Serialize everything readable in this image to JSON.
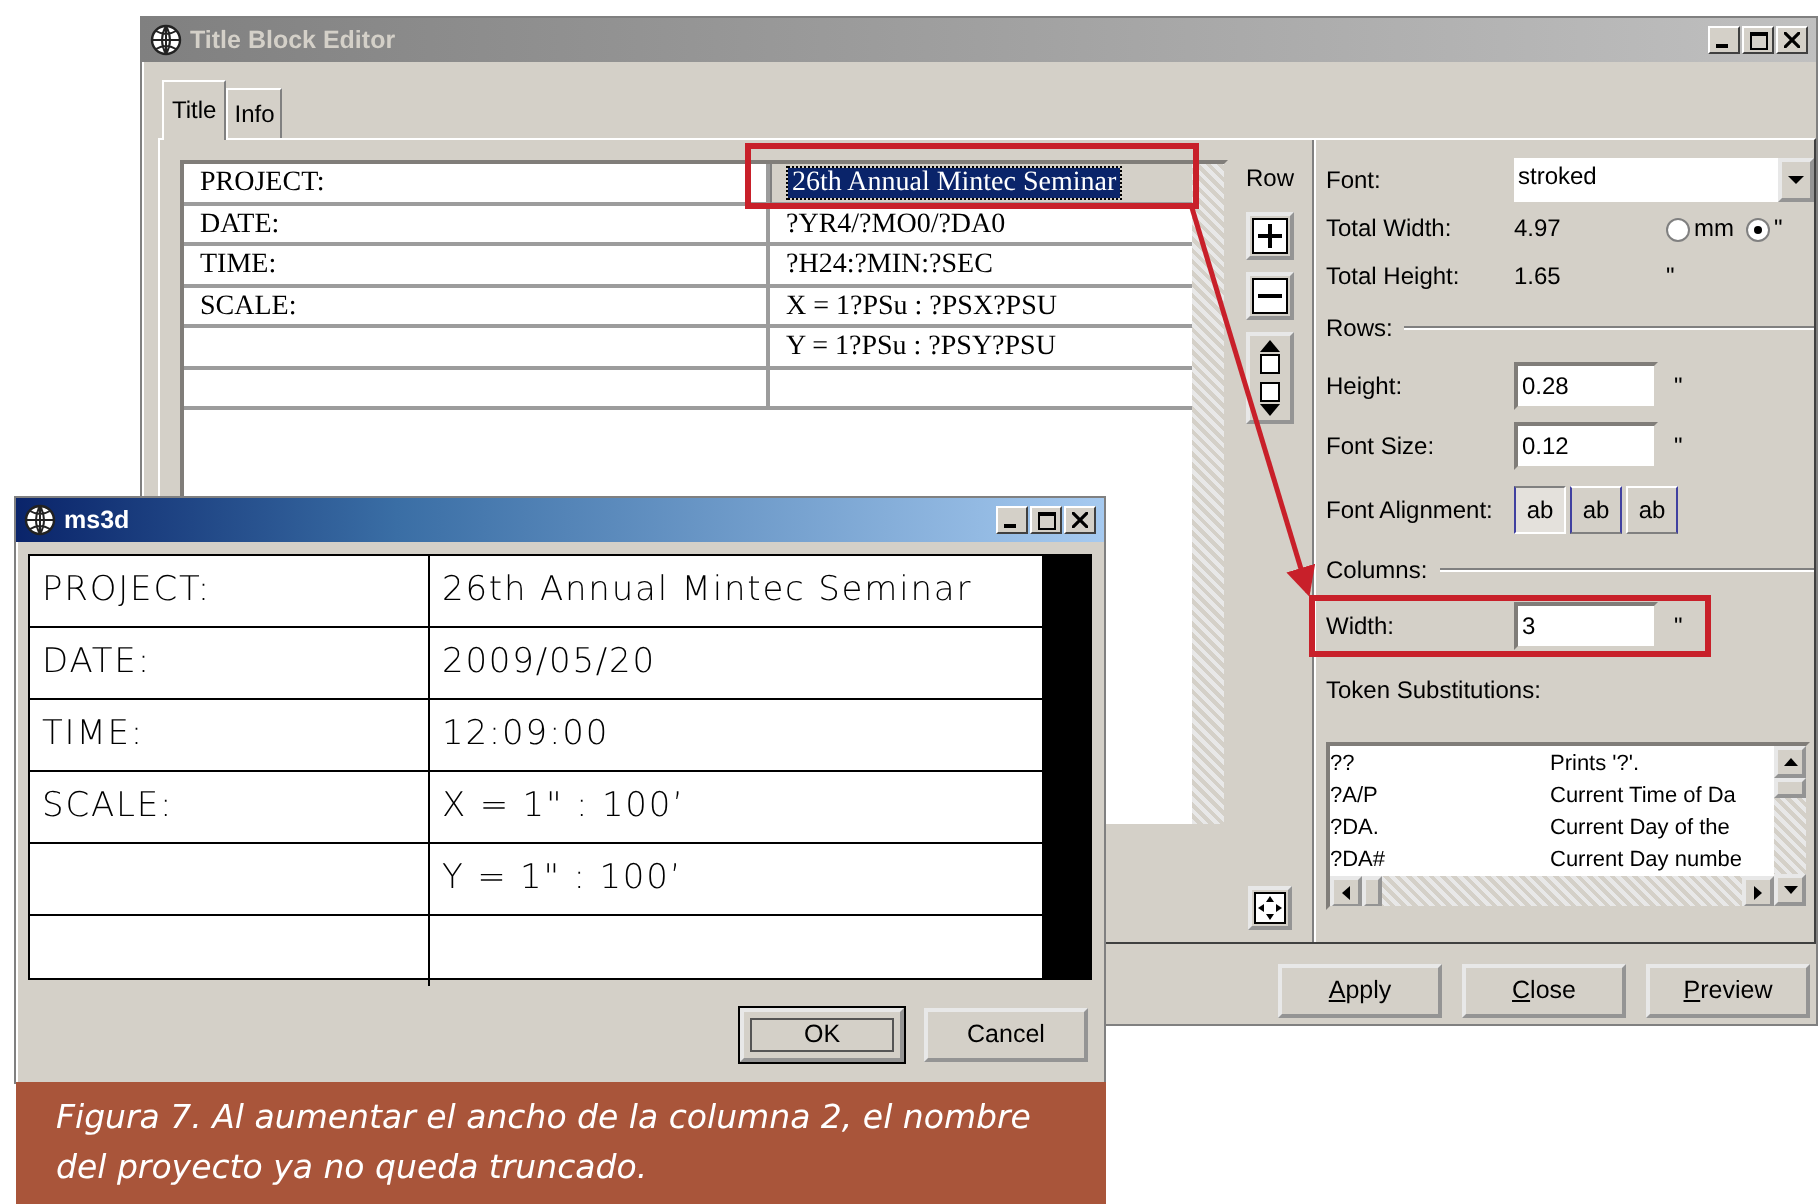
{
  "editor": {
    "title": "Title Block Editor",
    "tabs": [
      {
        "label": "Title",
        "selected": true
      },
      {
        "label": "Info",
        "selected": false
      }
    ],
    "grid_rows": [
      {
        "label": "PROJECT:",
        "value": "26th Annual Mintec Seminar",
        "selected": true
      },
      {
        "label": "DATE:",
        "value": "?YR4/?MO0/?DA0",
        "selected": false
      },
      {
        "label": "TIME:",
        "value": "?H24:?MIN:?SEC",
        "selected": false
      },
      {
        "label": "SCALE:",
        "value": "X = 1?PSu : ?PSX?PSU",
        "selected": false
      },
      {
        "label": "",
        "value": "Y = 1?PSu : ?PSY?PSU",
        "selected": false
      },
      {
        "label": "",
        "value": "",
        "selected": false
      }
    ],
    "row_label": "Row",
    "font": {
      "label": "Font:",
      "value": "stroked"
    },
    "total_width": {
      "label": "Total Width:",
      "value": "4.97"
    },
    "units": [
      {
        "label": "mm",
        "selected": false
      },
      {
        "label": "\"",
        "selected": true
      }
    ],
    "total_height": {
      "label": "Total Height:",
      "value": "1.65",
      "unit": "\""
    },
    "rows_heading": "Rows:",
    "row_fields": [
      {
        "label": "Height:",
        "value": "0.28",
        "unit": "\""
      },
      {
        "label": "Font Size:",
        "value": "0.12",
        "unit": "\""
      }
    ],
    "font_alignment": {
      "label": "Font Alignment:",
      "options": [
        {
          "text": "ab",
          "kind": "left",
          "selected": true
        },
        {
          "text": "ab",
          "kind": "center",
          "selected": false
        },
        {
          "text": "ab",
          "kind": "right",
          "selected": false
        }
      ]
    },
    "columns_heading": "Columns:",
    "column_width": {
      "label": "Width:",
      "value": "3",
      "unit": "\""
    },
    "tokens": {
      "label": "Token Substitutions:",
      "rows": [
        [
          "??",
          "Prints '?'."
        ],
        [
          "?A/P",
          "Current Time of Da"
        ],
        [
          "?DA.",
          "Current Day of the"
        ],
        [
          "?DA#",
          "Current Day numbe"
        ]
      ]
    },
    "buttons": [
      "Apply",
      "Close",
      "Preview"
    ]
  },
  "preview": {
    "title": "ms3d",
    "rows": [
      [
        "PROJECT:",
        "26th Annual Mintec Seminar"
      ],
      [
        "DATE:",
        "2009/05/20"
      ],
      [
        "TIME:",
        "12:09:00"
      ],
      [
        "SCALE:",
        "X = 1\" : 100’"
      ],
      [
        "",
        "Y = 1\" : 100’"
      ],
      [
        "",
        ""
      ]
    ],
    "buttons": [
      {
        "label": "OK",
        "default": true
      },
      {
        "label": "Cancel",
        "default": false
      }
    ]
  },
  "caption": "Figura 7. Al aumentar el ancho de la columna 2, el nombre del proyecto ya no queda truncado."
}
